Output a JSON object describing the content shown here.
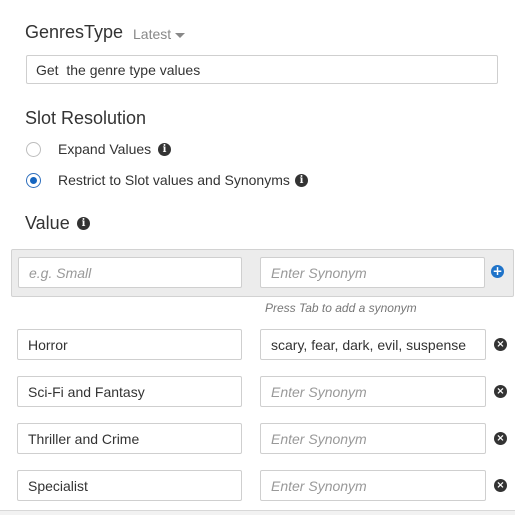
{
  "slot_type": {
    "name": "GenresType",
    "version_label": "Latest",
    "description_value": "Get  the genre type values"
  },
  "slot_resolution": {
    "title": "Slot Resolution",
    "options": [
      {
        "label": "Expand Values",
        "selected": false
      },
      {
        "label": "Restrict to Slot values and Synonyms",
        "selected": true
      }
    ]
  },
  "values_section": {
    "title": "Value",
    "new_value_placeholder": "e.g. Small",
    "synonym_placeholder": "Enter Synonym",
    "hint": "Press Tab to add a synonym",
    "rows": [
      {
        "value": "Horror",
        "synonyms": "scary, fear, dark, evil, suspense"
      },
      {
        "value": "Sci-Fi and Fantasy",
        "synonyms": ""
      },
      {
        "value": "Thriller and Crime",
        "synonyms": ""
      },
      {
        "value": "Specialist",
        "synonyms": ""
      }
    ]
  },
  "icons": {
    "info": "info-icon",
    "add": "plus-circle-icon",
    "remove": "times-circle-icon",
    "dropdown": "caret-down-icon"
  },
  "colors": {
    "accent": "#1f73c9",
    "new_row_background": "#ececec"
  }
}
